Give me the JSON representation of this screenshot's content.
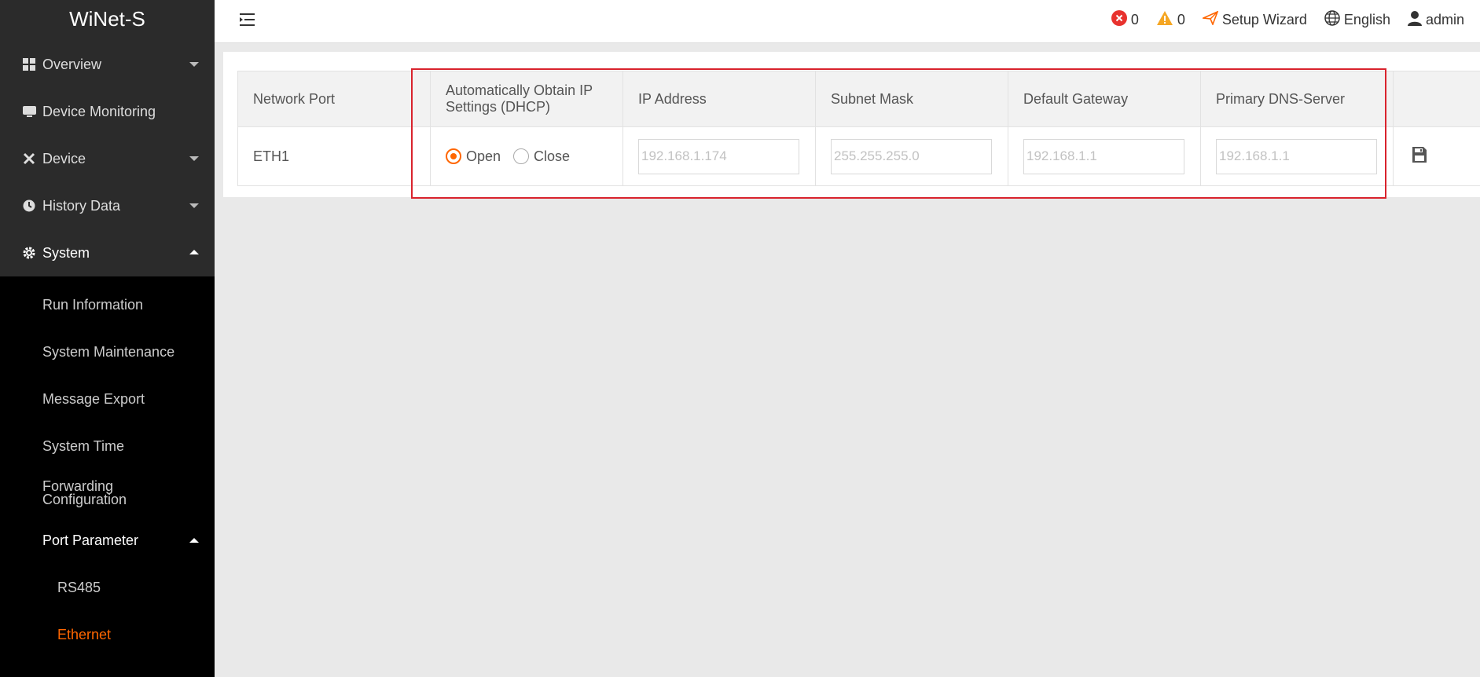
{
  "app": {
    "title": "WiNet-S"
  },
  "colors": {
    "accent": "#ff6600",
    "sidebar_bg": "#000000",
    "highlight": "#d9232d"
  },
  "sidebar": {
    "items": [
      {
        "label": "Overview",
        "icon": "grid-icon"
      },
      {
        "label": "Device Monitoring",
        "icon": "monitor-icon"
      },
      {
        "label": "Device",
        "icon": "tools-icon"
      },
      {
        "label": "History Data",
        "icon": "clock-icon"
      },
      {
        "label": "System",
        "icon": "gear-icon"
      }
    ],
    "system_sub": [
      "Run Information",
      "System Maintenance",
      "Message Export",
      "System Time",
      "Forwarding Configuration",
      "Port Parameter"
    ],
    "port_sub": [
      "RS485",
      "Ethernet"
    ]
  },
  "topbar": {
    "error_count": "0",
    "warning_count": "0",
    "setup_wizard": "Setup Wizard",
    "language": "English",
    "user": "admin"
  },
  "table": {
    "headers": [
      "Network Port",
      "Automatically Obtain IP Settings (DHCP)",
      "IP Address",
      "Subnet Mask",
      "Default Gateway",
      "Primary DNS-Server"
    ],
    "row": {
      "port": "ETH1",
      "dhcp_open": "Open",
      "dhcp_close": "Close",
      "ip": "192.168.1.174",
      "mask": "255.255.255.0",
      "gateway": "192.168.1.1",
      "dns": "192.168.1.1"
    }
  }
}
